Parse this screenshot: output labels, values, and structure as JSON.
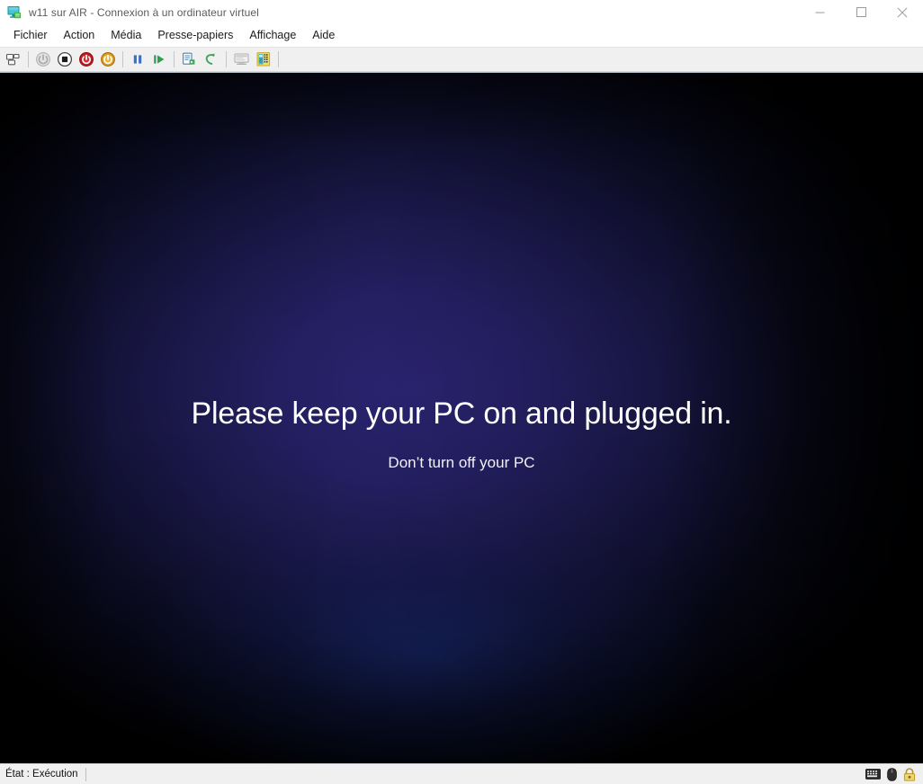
{
  "window": {
    "title": "w11 sur AIR - Connexion à un ordinateur virtuel",
    "icon_name": "virtual-machine-monitor-icon",
    "controls": {
      "minimize_label": "Réduire",
      "maximize_label": "Agrandir",
      "close_label": "Fermer"
    }
  },
  "menubar": {
    "items": [
      {
        "label": "Fichier",
        "name": "menu-fichier"
      },
      {
        "label": "Action",
        "name": "menu-action"
      },
      {
        "label": "Média",
        "name": "menu-media"
      },
      {
        "label": "Presse-papiers",
        "name": "menu-presse-papiers"
      },
      {
        "label": "Affichage",
        "name": "menu-affichage"
      },
      {
        "label": "Aide",
        "name": "menu-aide"
      }
    ]
  },
  "toolbar": {
    "buttons": [
      {
        "name": "ctrl-alt-del-button",
        "icon": "keyboard-keys-icon",
        "tooltip": "Ctrl+Alt+Suppr",
        "enabled": true
      },
      {
        "name": "start-button",
        "icon": "power-start-icon",
        "tooltip": "Démarrer",
        "enabled": false
      },
      {
        "name": "turn-off-button",
        "icon": "stop-square-icon",
        "tooltip": "Arrêter",
        "enabled": true
      },
      {
        "name": "shut-down-button",
        "icon": "power-red-icon",
        "tooltip": "Arrêt",
        "enabled": true
      },
      {
        "name": "save-button",
        "icon": "power-amber-icon",
        "tooltip": "Enregistrer",
        "enabled": true
      },
      {
        "name": "pause-button",
        "icon": "pause-icon",
        "tooltip": "Suspendre",
        "enabled": true
      },
      {
        "name": "resume-button",
        "icon": "resume-play-icon",
        "tooltip": "Reprendre",
        "enabled": true
      },
      {
        "name": "checkpoint-button",
        "icon": "checkpoint-document-icon",
        "tooltip": "Point de contrôle",
        "enabled": true
      },
      {
        "name": "revert-button",
        "icon": "revert-arrow-icon",
        "tooltip": "Rétablir",
        "enabled": true
      },
      {
        "name": "basic-session-button",
        "icon": "basic-session-monitor-icon",
        "tooltip": "Session de base",
        "enabled": false
      },
      {
        "name": "enhanced-session-button",
        "icon": "enhanced-session-icon",
        "tooltip": "Session étendue",
        "enabled": true
      }
    ]
  },
  "vm_screen": {
    "headline": "Please keep your PC on and plugged in.",
    "subtitle": "Don’t turn off your PC",
    "background_center_color": "#272069",
    "background_edge_color": "#000000",
    "text_color": "#ffffff"
  },
  "statusbar": {
    "state_text": "État : Exécution",
    "icons": [
      {
        "name": "keyboard-capture-icon",
        "label": "Clavier"
      },
      {
        "name": "mouse-capture-icon",
        "label": "Souris"
      },
      {
        "name": "lock-icon",
        "label": "Verrouillé"
      }
    ]
  }
}
